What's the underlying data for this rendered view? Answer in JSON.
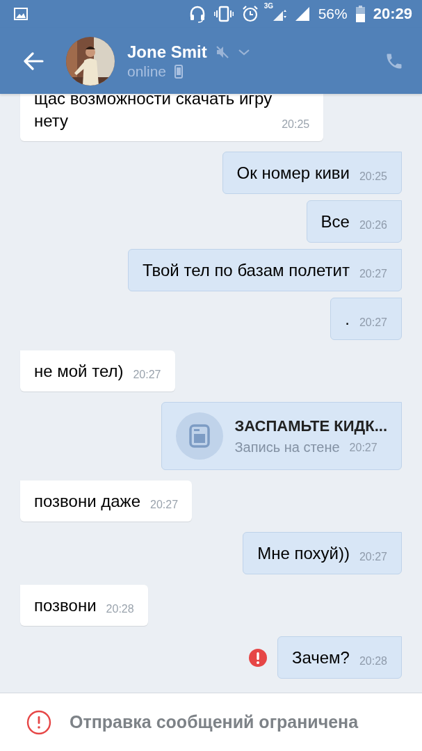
{
  "status_bar": {
    "network": "3G",
    "battery": "56%",
    "time": "20:29"
  },
  "header": {
    "name": "Jone Smit",
    "muted": true,
    "presence": "online",
    "mobile": true
  },
  "messages": [
    {
      "kind": "text",
      "outgoing": false,
      "text": "щас возможности скачать игру\nнету",
      "time": "20:25",
      "failed": false
    },
    {
      "kind": "text",
      "outgoing": true,
      "text": "Ок номер киви",
      "time": "20:25",
      "failed": false
    },
    {
      "kind": "text",
      "outgoing": true,
      "text": "Все",
      "time": "20:26",
      "failed": false
    },
    {
      "kind": "text",
      "outgoing": true,
      "text": "Твой тел по базам полетит",
      "time": "20:27",
      "failed": false
    },
    {
      "kind": "text",
      "outgoing": true,
      "text": ".",
      "time": "20:27",
      "failed": false
    },
    {
      "kind": "text",
      "outgoing": false,
      "text": "не мой тел)",
      "time": "20:27",
      "failed": false
    },
    {
      "kind": "wall_post",
      "outgoing": true,
      "title": "ЗАСПАМЬТЕ КИДК...",
      "subtitle": "Запись на стене",
      "time": "20:27",
      "failed": false
    },
    {
      "kind": "text",
      "outgoing": false,
      "text": "позвони даже",
      "time": "20:27",
      "failed": false
    },
    {
      "kind": "text",
      "outgoing": true,
      "text": "Мне похуй))",
      "time": "20:27",
      "failed": false
    },
    {
      "kind": "text",
      "outgoing": false,
      "text": "позвони",
      "time": "20:28",
      "failed": false
    },
    {
      "kind": "text",
      "outgoing": true,
      "text": "Зачем?",
      "time": "20:28",
      "failed": true
    }
  ],
  "footer": {
    "notice": "Отправка сообщений ограничена"
  }
}
